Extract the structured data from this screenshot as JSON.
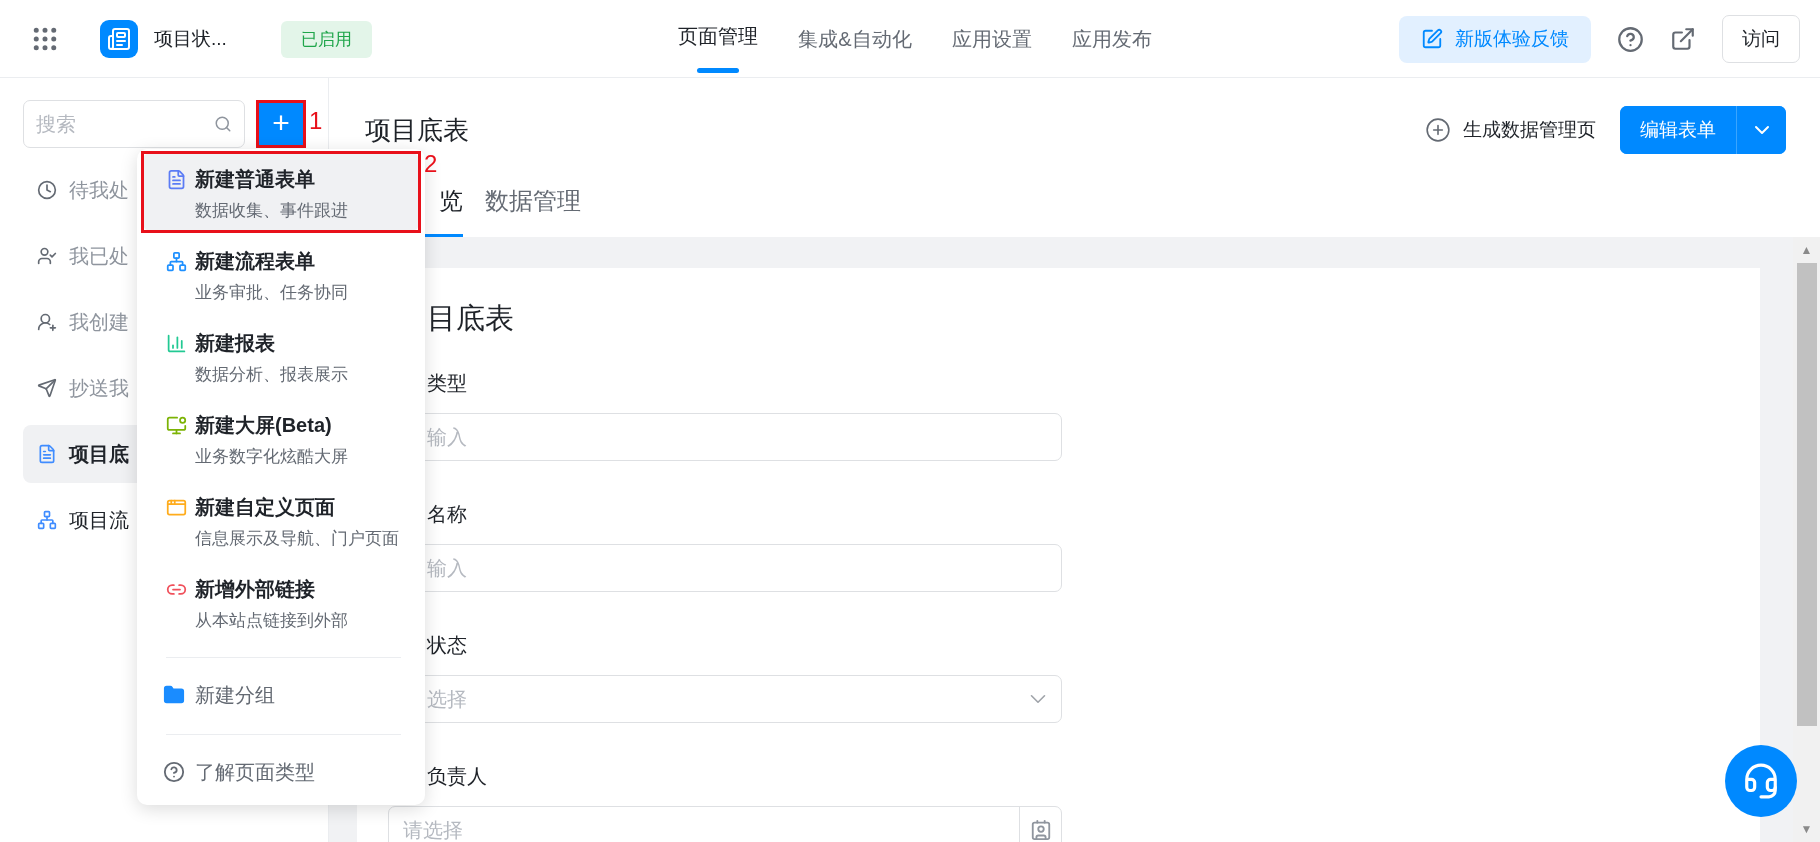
{
  "app_bar": {
    "app_name": "项目状...",
    "status_badge": "已启用",
    "nav_tabs": [
      {
        "label": "页面管理",
        "selected": true
      },
      {
        "label": "集成&自动化",
        "selected": false
      },
      {
        "label": "应用设置",
        "selected": false
      },
      {
        "label": "应用发布",
        "selected": false
      }
    ],
    "feedback_button": "新版体验反馈",
    "visit_button": "访问"
  },
  "sidebar": {
    "search": {
      "placeholder": "搜索"
    },
    "add_button": {
      "label": "+",
      "annotation": "1"
    },
    "items": [
      {
        "label": "待我处",
        "kind": "clock",
        "selected": false
      },
      {
        "label": "我已处",
        "kind": "done",
        "selected": false
      },
      {
        "label": "我创建",
        "kind": "created",
        "selected": false
      },
      {
        "label": "抄送我",
        "kind": "cc",
        "selected": false
      },
      {
        "label": "项目底",
        "kind": "form",
        "selected": true
      },
      {
        "label": "项目流",
        "kind": "flow",
        "selected": false
      }
    ]
  },
  "new_menu": {
    "open": true,
    "items": [
      {
        "kind": "form",
        "title": "新建普通表单",
        "subtitle": "数据收集、事件跟进",
        "highlighted": true,
        "annotation": "2"
      },
      {
        "kind": "flow",
        "title": "新建流程表单",
        "subtitle": "业务审批、任务协同",
        "highlighted": false
      },
      {
        "kind": "report",
        "title": "新建报表",
        "subtitle": "数据分析、报表展示",
        "highlighted": false
      },
      {
        "kind": "screen",
        "title": "新建大屏(Beta)",
        "subtitle": "业务数字化炫酷大屏",
        "highlighted": false
      },
      {
        "kind": "custom",
        "title": "新建自定义页面",
        "subtitle": "信息展示及导航、门户页面",
        "highlighted": false
      },
      {
        "kind": "link",
        "title": "新增外部链接",
        "subtitle": "从本站点链接到外部",
        "highlighted": false
      }
    ],
    "group_item": "新建分组",
    "help_item": "了解页面类型"
  },
  "page": {
    "title": "项目底表",
    "generate_button": "生成数据管理页",
    "edit_button": "编辑表单",
    "tabs": [
      {
        "label": "览",
        "selected": true
      },
      {
        "label": "数据管理",
        "selected": false
      }
    ],
    "form": {
      "title": "目底表",
      "fields": [
        {
          "label": "类型",
          "placeholder": "输入",
          "kind": "text"
        },
        {
          "label": "名称",
          "placeholder": "输入",
          "kind": "text"
        },
        {
          "label": "状态",
          "placeholder": "选择",
          "kind": "select"
        },
        {
          "label": "负责人",
          "placeholder": "请选择",
          "kind": "member"
        }
      ]
    }
  },
  "scrollbar": {
    "up_arrow": "▲",
    "down_arrow": "▼"
  }
}
